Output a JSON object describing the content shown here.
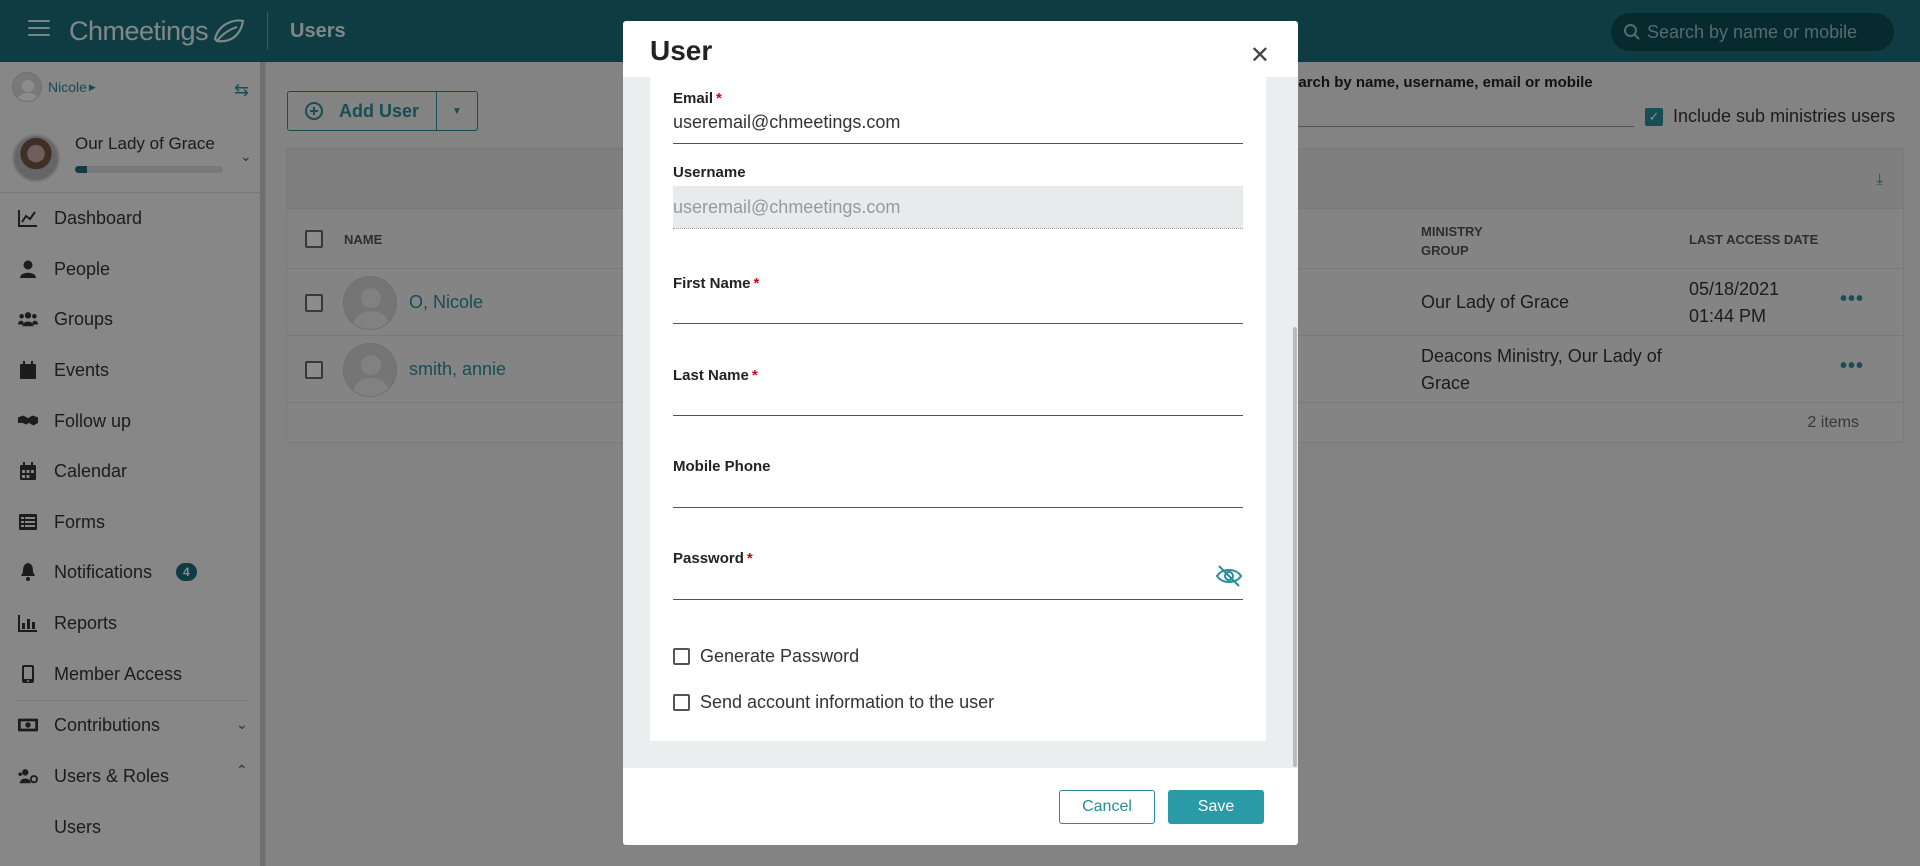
{
  "app": {
    "logo": "Chmeetings",
    "page_title": "Users",
    "search_placeholder": "Search by name or mobile"
  },
  "sidebar": {
    "user_name": "Nicole",
    "org_name": "Our Lady of Grace",
    "org_progress": 0.08,
    "items": [
      {
        "label": "Dashboard",
        "icon": "chart-line-icon"
      },
      {
        "label": "People",
        "icon": "person-icon"
      },
      {
        "label": "Groups",
        "icon": "users-icon"
      },
      {
        "label": "Events",
        "icon": "calendar-day-icon"
      },
      {
        "label": "Follow up",
        "icon": "handshake-icon"
      },
      {
        "label": "Calendar",
        "icon": "calendar-icon"
      },
      {
        "label": "Forms",
        "icon": "list-icon"
      },
      {
        "label": "Notifications",
        "icon": "bell-icon",
        "badge": "4"
      },
      {
        "label": "Reports",
        "icon": "bar-chart-icon"
      },
      {
        "label": "Member Access",
        "icon": "mobile-icon"
      },
      {
        "label": "Contributions",
        "icon": "money-icon"
      },
      {
        "label": "Users & Roles",
        "icon": "users-cog-icon"
      },
      {
        "label": "Users",
        "icon": ""
      }
    ]
  },
  "toolbar": {
    "add_user": "Add User",
    "filter_label": "Search by name, username, email or mobile",
    "include_sub": "Include sub ministries users"
  },
  "grid": {
    "columns": {
      "name": "NAME",
      "ministry_line1": "MINISTRY",
      "ministry_line2": "GROUP",
      "last_access": "LAST ACCESS DATE"
    },
    "rows": [
      {
        "name": "O, Nicole",
        "ministry": "Our Lady of Grace",
        "date_line1": "05/18/2021",
        "date_line2": "01:44 PM"
      },
      {
        "name": "smith, annie",
        "ministry_line1": "Deacons Ministry, Our Lady of",
        "ministry_line2": "Grace",
        "date_line1": "",
        "date_line2": ""
      }
    ],
    "footer": "2 items"
  },
  "modal": {
    "title": "User",
    "email_label": "Email",
    "email_value": "useremail@chmeetings.com",
    "username_label": "Username",
    "username_value": "useremail@chmeetings.com",
    "first_name_label": "First Name",
    "last_name_label": "Last Name",
    "mobile_label": "Mobile Phone",
    "password_label": "Password",
    "generate_password": "Generate Password",
    "send_info": "Send account information to the user",
    "cancel": "Cancel",
    "save": "Save",
    "required_mark": "*"
  },
  "colors": {
    "brand": "#1d6e7a",
    "accent": "#2a8c99",
    "required": "#d0021b"
  }
}
